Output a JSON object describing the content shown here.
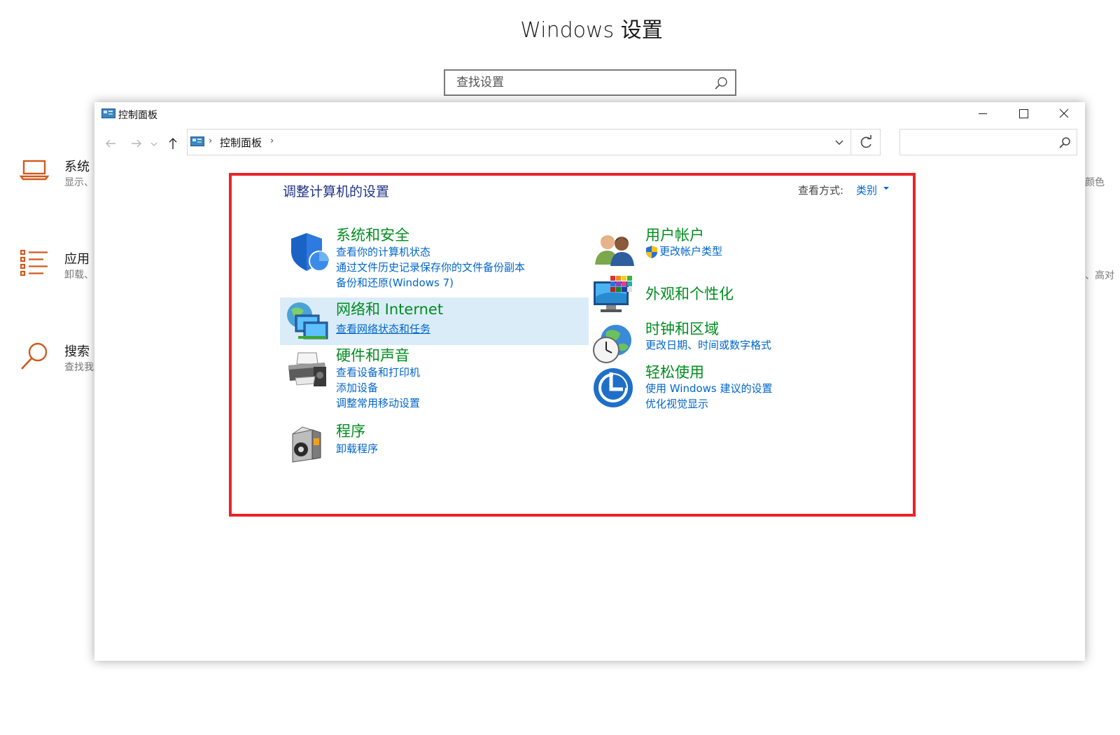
{
  "settings": {
    "title": "Windows 设置",
    "search_placeholder": "查找设置",
    "categories": [
      {
        "title": "系统",
        "desc": "显示、",
        "icon": "laptop-icon"
      },
      {
        "title": "应用",
        "desc": "卸载、",
        "icon": "apps-list-icon"
      },
      {
        "title": "搜索",
        "desc": "查找我",
        "icon": "search-icon"
      }
    ],
    "right_fragments": [
      "颜色",
      "、高对"
    ]
  },
  "window": {
    "title": "控制面板",
    "breadcrumb": "控制面板",
    "search_placeholder": ""
  },
  "content": {
    "heading": "调整计算机的设置",
    "view_by_label": "查看方式:",
    "view_by_value": "类别",
    "left_items": [
      {
        "title": "系统和安全",
        "links": [
          "查看你的计算机状态",
          "通过文件历史记录保存你的文件备份副本",
          "备份和还原(Windows 7)"
        ],
        "icon": "shield-icon"
      },
      {
        "title": "网络和 Internet",
        "links": [
          "查看网络状态和任务"
        ],
        "icon": "network-globe-icon"
      },
      {
        "title": "硬件和声音",
        "links": [
          "查看设备和打印机",
          "添加设备",
          "调整常用移动设置"
        ],
        "icon": "printer-icon"
      },
      {
        "title": "程序",
        "links": [
          "卸载程序"
        ],
        "icon": "programs-icon"
      }
    ],
    "right_items": [
      {
        "title": "用户帐户",
        "links": [
          "更改帐户类型"
        ],
        "icon": "users-icon"
      },
      {
        "title": "外观和个性化",
        "links": [],
        "icon": "monitor-palette-icon"
      },
      {
        "title": "时钟和区域",
        "links": [
          "更改日期、时间或数字格式"
        ],
        "icon": "clock-globe-icon"
      },
      {
        "title": "轻松使用",
        "links": [
          "使用 Windows 建议的设置",
          "优化视觉显示"
        ],
        "icon": "ease-of-access-icon"
      }
    ]
  },
  "colors": {
    "highlight": "#e8242a",
    "link": "#0066cc",
    "title_green": "#008d1e",
    "hover": "#dbecf9"
  }
}
